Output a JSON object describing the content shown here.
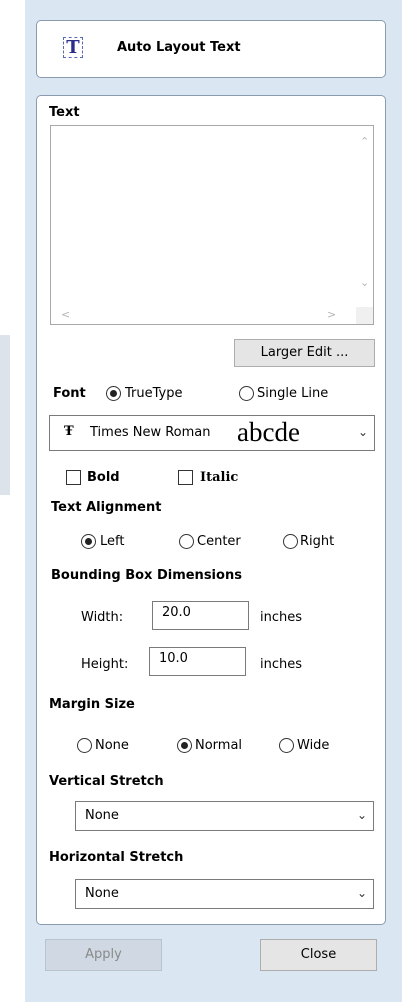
{
  "header": {
    "title": "Auto Layout Text",
    "icon": "T"
  },
  "text_section": {
    "label": "Text",
    "value": "",
    "larger_edit_label": "Larger Edit ..."
  },
  "font": {
    "label": "Font",
    "truetype_label": "TrueType",
    "single_line_label": "Single Line",
    "selected_mode": "TrueType",
    "font_name": "Times New Roman",
    "preview": "abcde",
    "icon_glyph": "Ŧ",
    "bold_label": "Bold",
    "italic_label": "Italic"
  },
  "alignment": {
    "label": "Text Alignment",
    "left": "Left",
    "center": "Center",
    "right": "Right",
    "selected": "Left"
  },
  "bounding": {
    "label": "Bounding Box Dimensions",
    "width_label": "Width:",
    "width_value": "20.0",
    "width_unit": "inches",
    "height_label": "Height:",
    "height_value": "10.0",
    "height_unit": "inches"
  },
  "margin": {
    "label": "Margin Size",
    "none": "None",
    "normal": "Normal",
    "wide": "Wide",
    "selected": "Normal"
  },
  "vertical_stretch": {
    "label": "Vertical Stretch",
    "value": "None"
  },
  "horizontal_stretch": {
    "label": "Horizontal Stretch",
    "value": "None"
  },
  "footer": {
    "apply_label": "Apply",
    "close_label": "Close"
  }
}
